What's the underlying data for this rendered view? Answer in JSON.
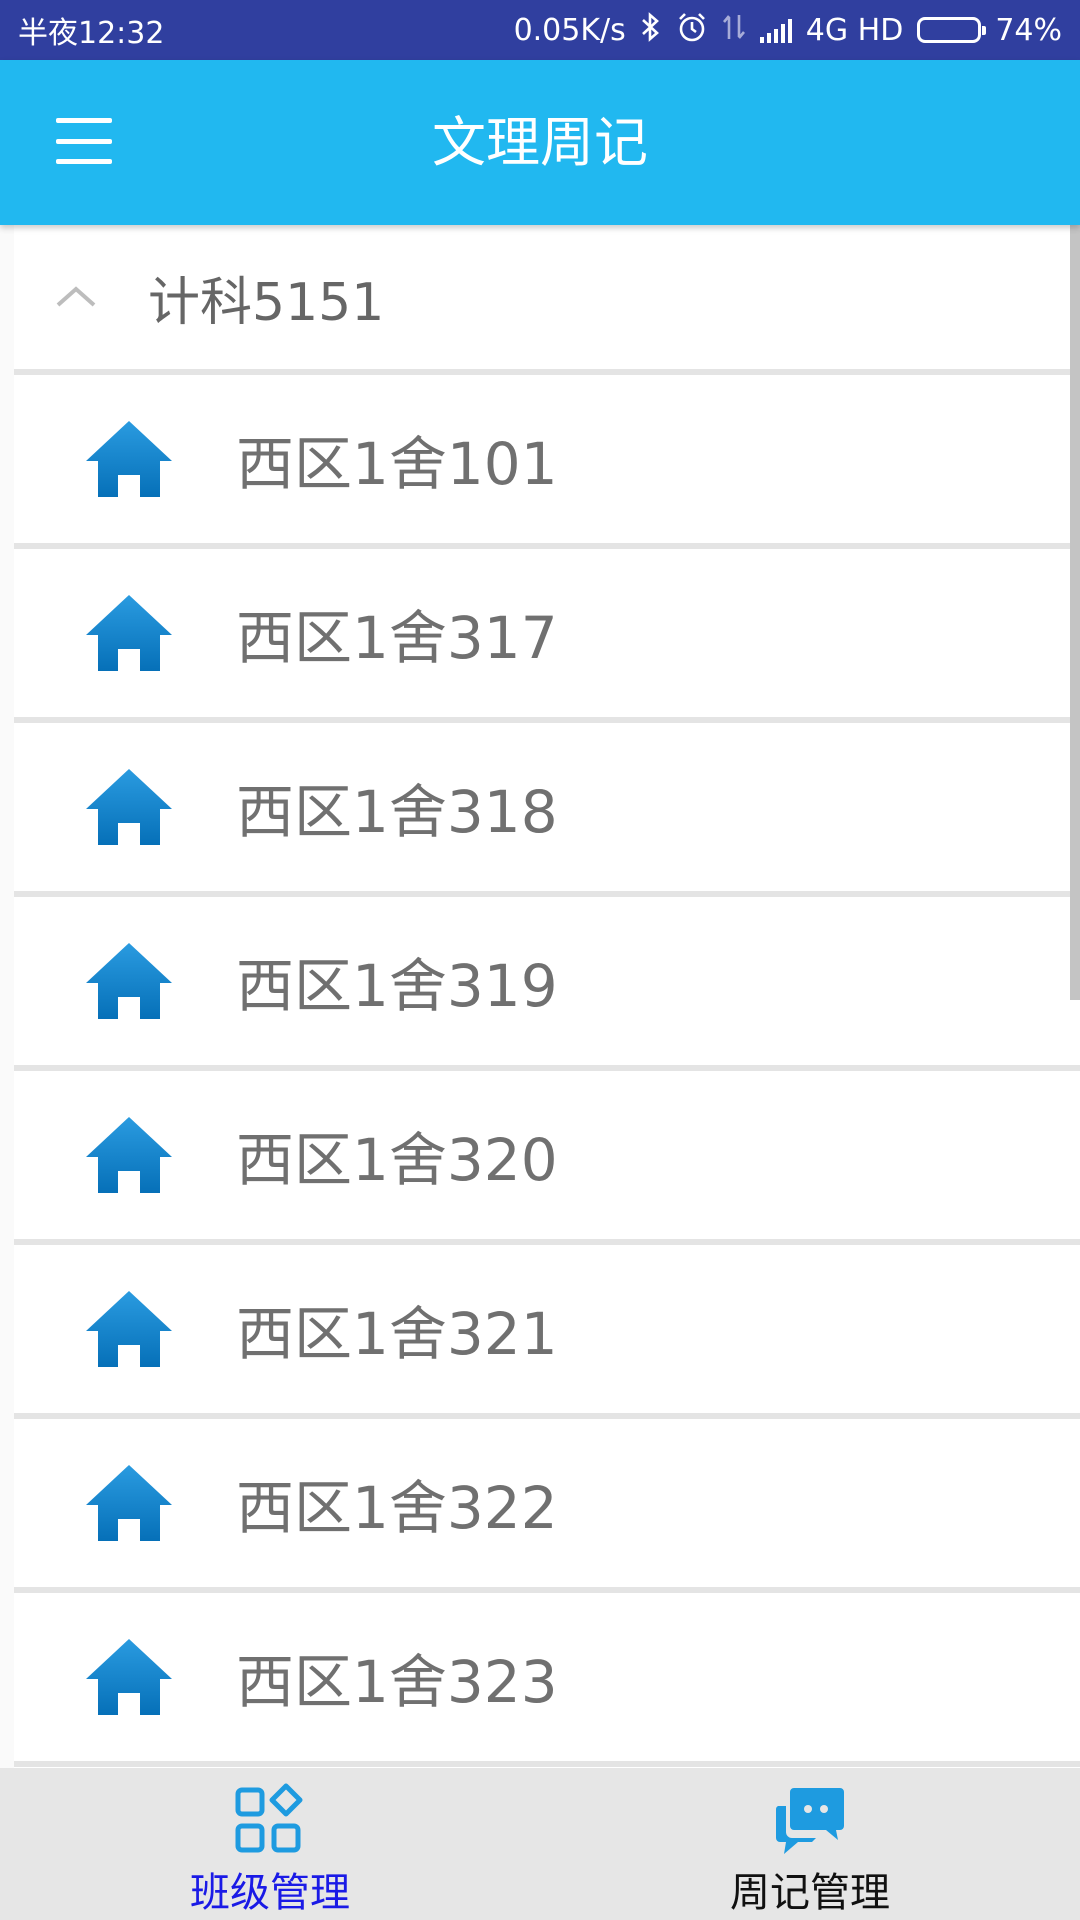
{
  "status_bar": {
    "time": "半夜12:32",
    "speed": "0.05K/s",
    "network": "4G HD",
    "battery": "74%",
    "battery_level": 0.74,
    "icons": [
      "bluetooth-icon",
      "alarm-icon",
      "data-arrows-icon",
      "signal-icon",
      "battery-icon"
    ]
  },
  "toolbar": {
    "title": "文理周记",
    "menu_icon": "hamburger-menu-icon"
  },
  "list": {
    "group": {
      "label": "计科5151",
      "expanded": true,
      "icon": "chevron-up-icon"
    },
    "rooms": [
      {
        "label": "西区1舍101",
        "icon": "house-icon"
      },
      {
        "label": "西区1舍317",
        "icon": "house-icon"
      },
      {
        "label": "西区1舍318",
        "icon": "house-icon"
      },
      {
        "label": "西区1舍319",
        "icon": "house-icon"
      },
      {
        "label": "西区1舍320",
        "icon": "house-icon"
      },
      {
        "label": "西区1舍321",
        "icon": "house-icon"
      },
      {
        "label": "西区1舍322",
        "icon": "house-icon"
      },
      {
        "label": "西区1舍323",
        "icon": "house-icon"
      }
    ]
  },
  "bottom_nav": {
    "items": [
      {
        "label": "班级管理",
        "icon": "grid-apps-icon",
        "active": true
      },
      {
        "label": "周记管理",
        "icon": "chat-bubbles-icon",
        "active": false
      }
    ]
  },
  "colors": {
    "status_bar": "#303F9F",
    "toolbar": "#21B8F0",
    "house_icon": "#0A84C8",
    "nav_active": "#1a1ae6",
    "nav_inactive": "#111111",
    "nav_icon": "#1E9BE0"
  }
}
